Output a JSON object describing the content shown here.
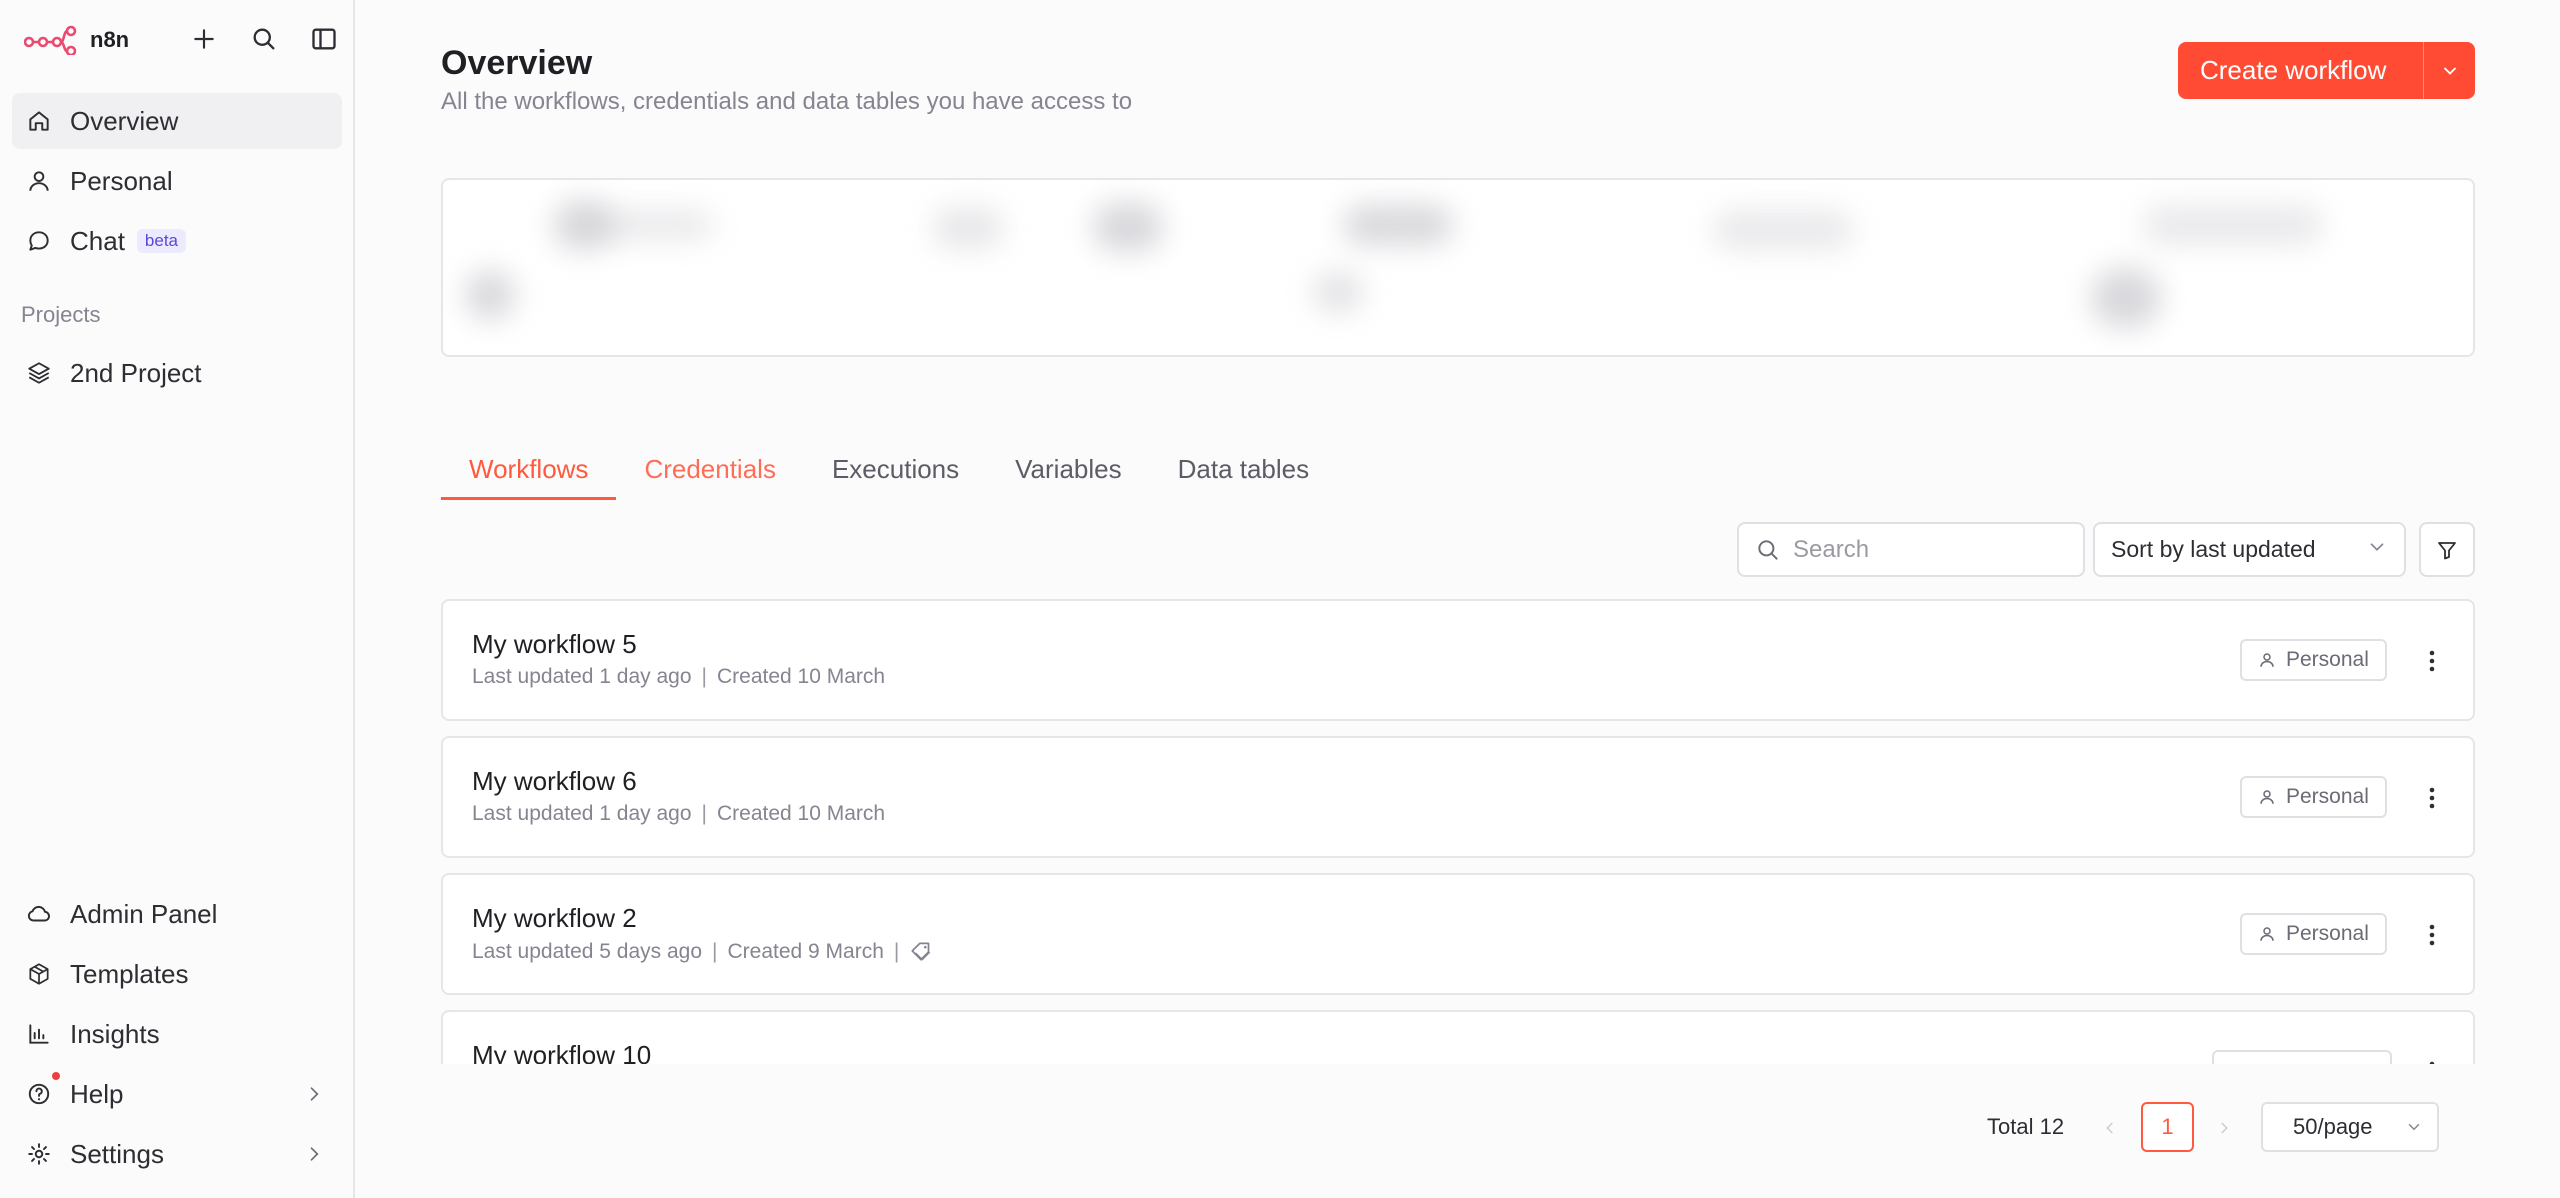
{
  "app": {
    "name": "n8n"
  },
  "colors": {
    "accent": "#ff5a3e",
    "primary_button": "#ff4b34",
    "beta_badge": "#5b49d6"
  },
  "sidebar": {
    "main_items": [
      {
        "label": "Overview",
        "icon": "home-icon",
        "active": true
      },
      {
        "label": "Personal",
        "icon": "user-icon"
      },
      {
        "label": "Chat",
        "icon": "chat-bubble-icon",
        "badge": "beta"
      }
    ],
    "projects_label": "Projects",
    "projects": [
      {
        "label": "2nd Project",
        "icon": "layers-icon"
      }
    ],
    "bottom_items": [
      {
        "label": "Admin Panel",
        "icon": "cloud-icon"
      },
      {
        "label": "Templates",
        "icon": "box-icon"
      },
      {
        "label": "Insights",
        "icon": "bar-chart-icon"
      },
      {
        "label": "Help",
        "icon": "help-icon"
      },
      {
        "label": "Settings",
        "icon": "gear-icon"
      }
    ]
  },
  "header": {
    "title": "Overview",
    "subtitle": "All the workflows, credentials and data tables you have access to",
    "create_button": "Create workflow"
  },
  "tabs": [
    {
      "label": "Workflows",
      "active": true
    },
    {
      "label": "Credentials",
      "hover": true
    },
    {
      "label": "Executions"
    },
    {
      "label": "Variables"
    },
    {
      "label": "Data tables"
    }
  ],
  "toolbar": {
    "search_placeholder": "Search",
    "sort_value": "Sort by last updated"
  },
  "workflows": [
    {
      "name": "My workflow 5",
      "updated": "Last updated 1 day ago",
      "created": "Created 10 March",
      "owner": "Personal"
    },
    {
      "name": "My workflow 6",
      "updated": "Last updated 1 day ago",
      "created": "Created 10 March",
      "owner": "Personal"
    },
    {
      "name": "My workflow 2",
      "updated": "Last updated 5 days ago",
      "created": "Created 9 March",
      "owner": "Personal",
      "has_tag_icon": true
    },
    {
      "name": "My workflow 10",
      "updated": "",
      "created": "",
      "owner": ""
    }
  ],
  "pagination": {
    "total": "Total 12",
    "current_page": "1",
    "page_size": "50/page"
  }
}
